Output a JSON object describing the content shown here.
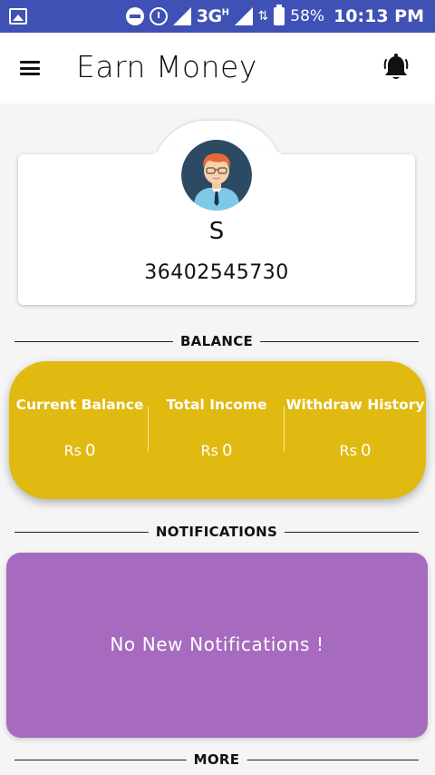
{
  "status_bar": {
    "network": "3G",
    "network_sup": "H",
    "battery": "58%",
    "time": "10:13 PM"
  },
  "app_bar": {
    "title": "Earn Money",
    "menu_icon": "menu-icon",
    "bell_icon": "bell-icon"
  },
  "profile": {
    "name": "S",
    "phone": "36402545730"
  },
  "balance": {
    "heading": "BALANCE",
    "items": [
      {
        "label": "Current Balance",
        "currency": "Rs",
        "value": "0"
      },
      {
        "label": "Total Income",
        "currency": "Rs",
        "value": "0"
      },
      {
        "label": "Withdraw History",
        "currency": "Rs",
        "value": "0"
      }
    ],
    "color": "#e0b911"
  },
  "notifications": {
    "heading": "NOTIFICATIONS",
    "message": "No New Notifications !",
    "color": "#a66bbe"
  },
  "more": {
    "heading": "MORE"
  },
  "colors": {
    "status_bar": "#3f51b5"
  }
}
